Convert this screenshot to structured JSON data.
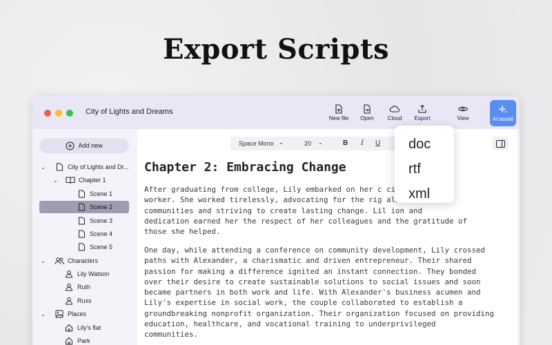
{
  "headline": "Export Scripts",
  "window": {
    "title": "City of Lights and Dreams"
  },
  "toolbar": {
    "new_file": "New file",
    "open": "Open",
    "cloud": "Cloud",
    "export": "Export",
    "view": "View",
    "ai_assist": "AI assist"
  },
  "sidebar": {
    "add_new": "Add new",
    "items": [
      {
        "label": "City of Lights and Dr...",
        "icon": "document-icon",
        "chevron": "expanded"
      },
      {
        "label": "Chapter 1",
        "icon": "book-icon",
        "chevron": "expanded"
      },
      {
        "label": "Scene 1",
        "icon": "page-icon"
      },
      {
        "label": "Scene 2",
        "icon": "page-icon",
        "selected": true
      },
      {
        "label": "Scene 3",
        "icon": "page-icon"
      },
      {
        "label": "Scene 4",
        "icon": "page-icon"
      },
      {
        "label": "Scene 5",
        "icon": "page-icon"
      },
      {
        "label": "Characters",
        "icon": "people-icon",
        "chevron": "expanded"
      },
      {
        "label": "Lily Watson",
        "icon": "person-icon"
      },
      {
        "label": "Ruth",
        "icon": "person-icon"
      },
      {
        "label": "Russ",
        "icon": "person-icon"
      },
      {
        "label": "Places",
        "icon": "image-icon",
        "chevron": "expanded"
      },
      {
        "label": "Lily's flat",
        "icon": "home-icon"
      },
      {
        "label": "Park",
        "icon": "home-icon"
      }
    ]
  },
  "format_bar": {
    "font": "Space Mono",
    "size": "20",
    "bold": "B",
    "italic": "I",
    "underline": "U"
  },
  "document": {
    "title": "Chapter 2: Embracing Change",
    "paragraph_1": "After graduating from college, Lily embarked on her c         cial\nworker. She worked tirelessly, advocating for the rig        alized\ncommunities and striving to create lasting change. Lil        ion and\ndedication earned her the respect of her colleagues and the gratitude of\nthose she helped.",
    "paragraph_2": "One day, while attending a conference on community development, Lily crossed\npaths with Alexander, a charismatic and driven entrepreneur. Their shared\npassion for making a difference ignited an instant connection. They bonded\nover their desire to create sustainable solutions to social issues and soon\nbecame partners in both work and life. With Alexander's business acumen and\nLily's expertise in social work, the couple collaborated to establish a\ngroundbreaking nonprofit organization. Their organization focused on providing\neducation, healthcare, and vocational training to underprivileged\ncommunities."
  },
  "export_menu": {
    "options": [
      "doc",
      "rtf",
      "xml"
    ]
  },
  "colors": {
    "accent": "#5a8df0",
    "selected_row": "#9e9bb3",
    "titlebar": "#e9e6f6"
  }
}
